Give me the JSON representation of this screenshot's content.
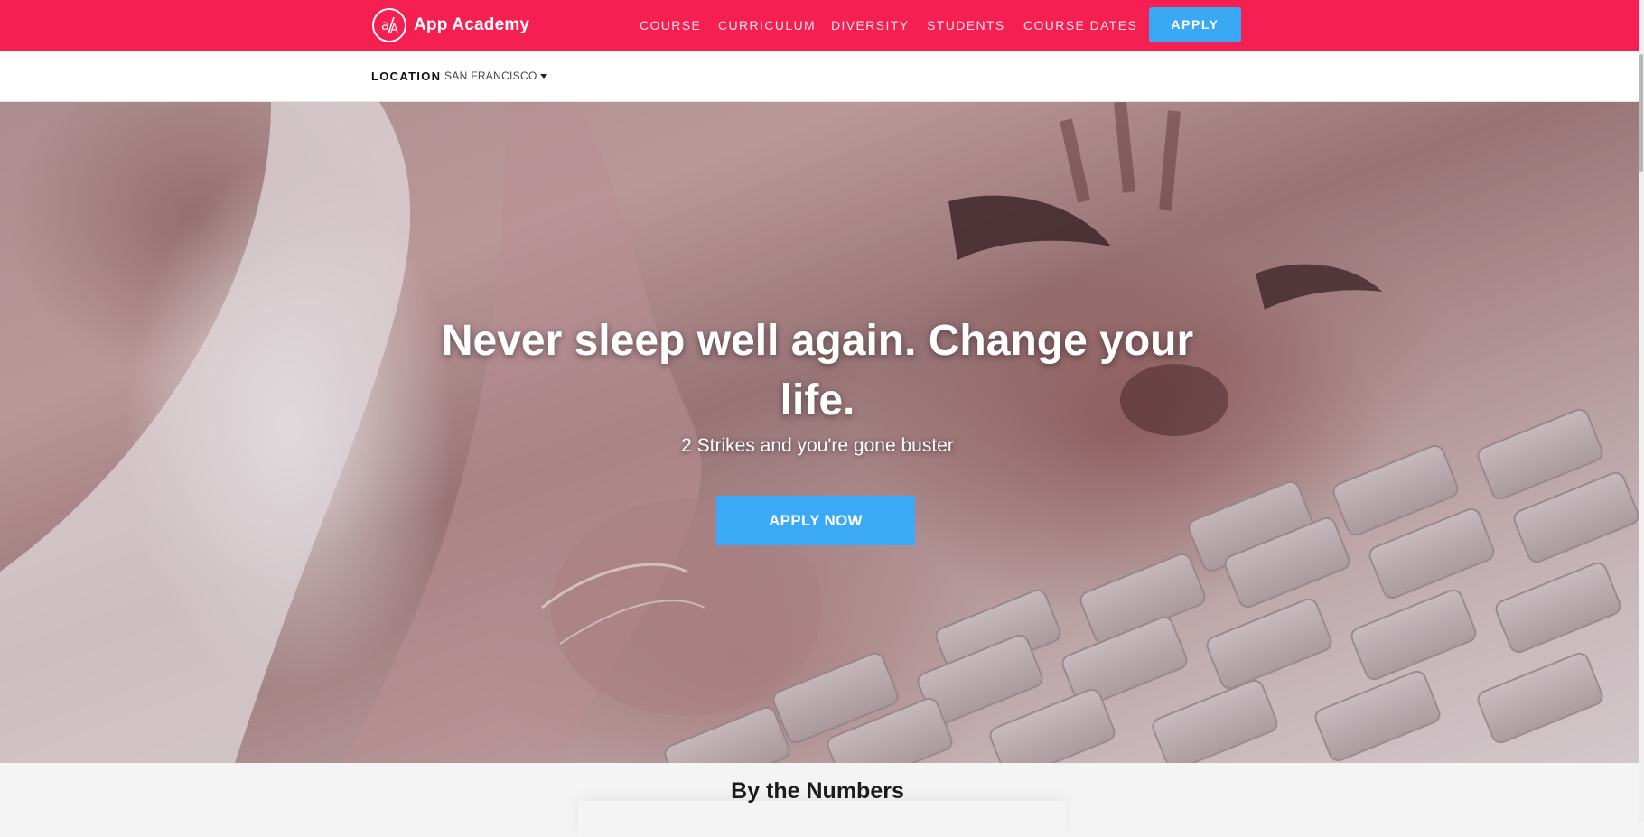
{
  "brand": {
    "name": "App Academy",
    "logo_icon": "app-academy-logo-icon",
    "color": "#f61f52"
  },
  "nav": {
    "links": [
      {
        "label": "COURSE"
      },
      {
        "label": "CURRICULUM"
      },
      {
        "label": "DIVERSITY"
      },
      {
        "label": "STUDENTS"
      },
      {
        "label": "COURSE DATES"
      }
    ],
    "apply_label": "APPLY",
    "apply_color": "#39a9f6"
  },
  "location": {
    "label": "LOCATION",
    "selected": "SAN FRANCISCO",
    "icon": "caret-down-icon"
  },
  "hero": {
    "title": "Never sleep well again. Change your life.",
    "subtitle": "2 Strikes and you're gone buster",
    "cta_label": "APPLY NOW",
    "cta_color": "#3aa9f6"
  },
  "numbers": {
    "title": "By the Numbers"
  }
}
